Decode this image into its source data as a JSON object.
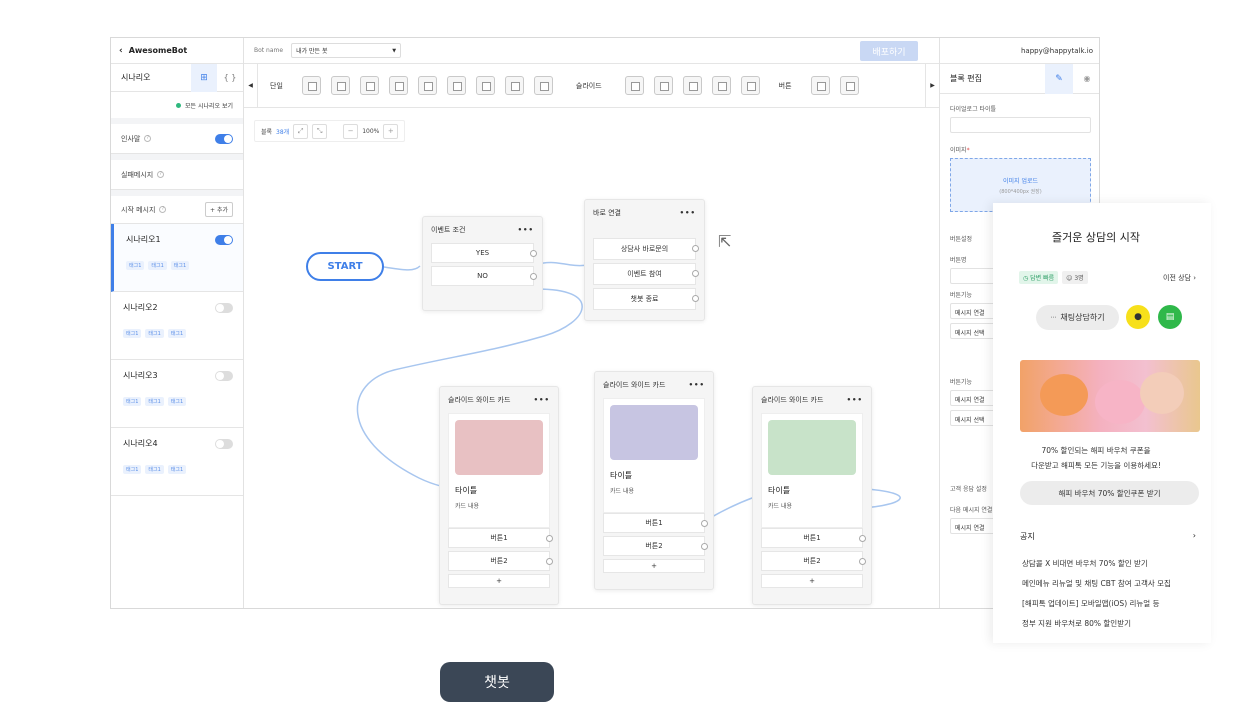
{
  "app": {
    "brand": "AwesomeBot",
    "user_email": "happy@happytalk.io",
    "deploy_label": "배포하기"
  },
  "left": {
    "tab_scenario": "시나리오",
    "all_scenarios": "모든 시나리오 보기",
    "greeting": "인사말",
    "fail_message": "실패메시지",
    "start_message": "시작 메시지",
    "add_label": "+ 추가",
    "scenarios": [
      {
        "name": "시나리오1",
        "tags": [
          "태그1",
          "태그1",
          "태그1"
        ]
      },
      {
        "name": "시나리오2",
        "tags": [
          "태그1",
          "태그1",
          "태그1"
        ]
      },
      {
        "name": "시나리오3",
        "tags": [
          "태그1",
          "태그1",
          "태그1"
        ]
      },
      {
        "name": "시나리오4",
        "tags": [
          "태그1",
          "태그1",
          "태그1"
        ]
      }
    ]
  },
  "topbar": {
    "bot_name_label": "Bot name",
    "bot_name_value": "내가 만든 봇"
  },
  "toolbar": {
    "single": "단일",
    "slide": "슬라이드",
    "button": "버튼"
  },
  "canvas": {
    "block_label": "블록",
    "block_count": "38개",
    "zoom": "100%",
    "start": "START",
    "event_node": {
      "title": "이벤트 조건",
      "options": [
        "YES",
        "NO"
      ]
    },
    "direct_node": {
      "title": "바로 연결",
      "options": [
        "상담사 바로문의",
        "이벤트 참여",
        "챗봇 종료"
      ]
    },
    "slide_title": "슬라이드 와이드 카드",
    "card_title": "타이틀",
    "card_content": "카드 내용",
    "btn1": "버튼1",
    "btn2": "버튼2",
    "plus": "+",
    "colors": {
      "pink": "#e8c1c3",
      "lavender": "#c7c5e2",
      "mint": "#c8e3c9",
      "accent": "#3f7fe8"
    }
  },
  "right": {
    "title": "블록 편집",
    "dialog_title": "다이얼로그 타이틀",
    "image_label": "이미지",
    "upload": "이미지 업로드",
    "upload_hint": "(800*400px 권장)",
    "button_settings": "버튼설정",
    "button_name": "버튼명",
    "button_func": "버튼기능",
    "msg_connect": "메시지 연결",
    "msg_select": "메시지 선택",
    "cust_settings": "고객 응답 설정",
    "next_msg": "다음 메시지 연결"
  },
  "popup": {
    "title": "즐거운 상담의 시작",
    "badge_status": "답변 빠름",
    "badge_count": "3명",
    "prev": "이전 상담",
    "chat_btn": "채팅상담하기",
    "promo_line1": "70% 할인되는 해피 바우처 쿠폰을",
    "promo_line2": "다운받고 해피톡 모든 기능을 이용하세요!",
    "coupon_btn": "해피 바우처 70% 할인쿠폰 받기",
    "notice": "공지",
    "notices": [
      "상담콜 X 비대면 바우처 70% 할인 받기",
      "메인메뉴 리뉴얼 및 채팅 CBT 참여 고객사 모집",
      "[해피톡 업데이트] 모바일앱(iOS) 리뉴얼 등",
      "정부 지원 바우처로 80% 할인받기"
    ]
  },
  "footer_label": "챗봇"
}
